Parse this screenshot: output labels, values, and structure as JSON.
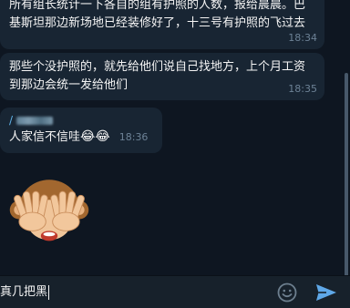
{
  "messages": [
    {
      "text": "所有组长统计一下各自的组有护照的人数，报给晨晨。巴基斯坦那边新场地已经装修好了，十三号有护照的飞过去",
      "time": "18:34"
    },
    {
      "text": "那些个没护照的，就先给他们说自己找地方，上个月工资到那边会统一发给他们",
      "time": "18:35"
    },
    {
      "sender_visible": "/",
      "text": "人家信不信哇",
      "emojis": "😂😂",
      "time": "18:36"
    }
  ],
  "sticker": {
    "icon": "see-no-evil-monkey"
  },
  "composer": {
    "input_value": "真几把黑",
    "emoji_icon": "smile-icon",
    "send_icon": "send-icon"
  },
  "colors": {
    "background": "#0e1621",
    "bubble": "#182533",
    "composer": "#17212b",
    "accent": "#5fa8e8",
    "time": "#6d8296"
  }
}
